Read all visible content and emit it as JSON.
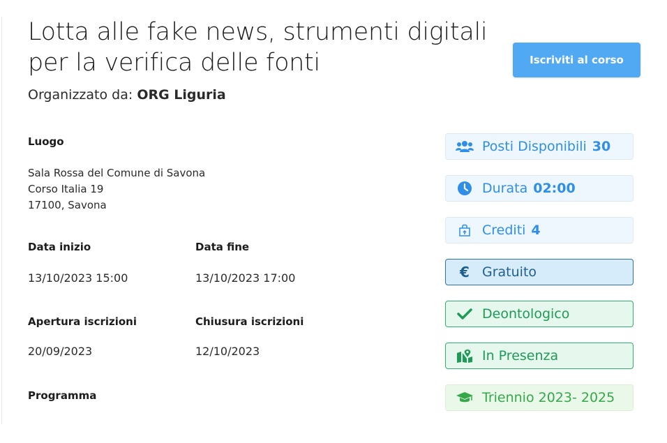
{
  "header": {
    "title_line1": "Lotta alle fake news, strumenti digitali",
    "title_line2": "per la verifica delle fonti",
    "organizer_prefix": "Organizzato da:",
    "organizer_name": "ORG Liguria",
    "enroll_button": "Iscriviti al corso"
  },
  "details": {
    "location_label": "Luogo",
    "location_lines": [
      "Sala Rossa del Comune di Savona",
      "Corso Italia 19",
      "17100, Savona"
    ],
    "start_label": "Data inizio",
    "start_value": "13/10/2023 15:00",
    "end_label": "Data fine",
    "end_value": "13/10/2023 17:00",
    "reg_open_label": "Apertura iscrizioni",
    "reg_open_value": "20/09/2023",
    "reg_close_label": "Chiusura iscrizioni",
    "reg_close_value": "12/10/2023",
    "program_label": "Programma"
  },
  "badges": {
    "seats": {
      "label": "Posti Disponibili",
      "value": "30",
      "icon": "users-icon"
    },
    "duration": {
      "label": "Durata",
      "value": "02:00",
      "icon": "clock-icon"
    },
    "credits": {
      "label": "Crediti",
      "value": "4",
      "icon": "bag-icon"
    },
    "free": {
      "label": "Gratuito",
      "icon": "euro-icon"
    },
    "deontological": {
      "label": "Deontologico",
      "icon": "check-icon"
    },
    "in_person": {
      "label": "In Presenza",
      "icon": "map-icon"
    },
    "triennium": {
      "label": "Triennio 2023- 2025",
      "icon": "graduation-cap-icon"
    }
  },
  "colors": {
    "primary_button": "#50a9f2",
    "badge_blue_text": "#2f8fe6",
    "badge_info_border": "#2c73a9",
    "badge_green_text": "#1f9a57"
  }
}
